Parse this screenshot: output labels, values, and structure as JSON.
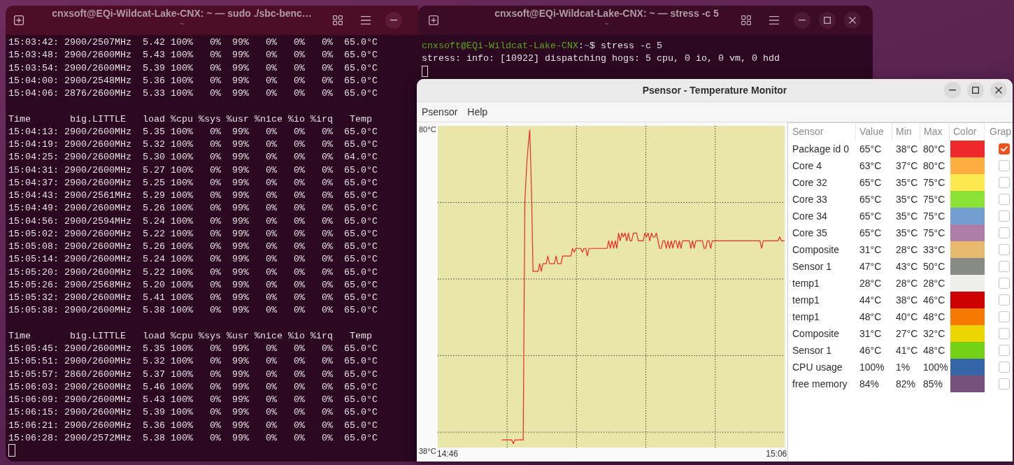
{
  "left_terminal": {
    "title": "cnxsoft@EQi-Wildcat-Lake-CNX: ~ — sudo ./sbc-benc…",
    "subtitle": "~",
    "blocks": [
      {
        "lines": [
          "15:03:42: 2900/2507MHz  5.42 100%   0%  99%   0%   0%   0%  65.0°C",
          "15:03:48: 2900/2600MHz  5.43 100%   0%  99%   0%   0%   0%  65.0°C",
          "15:03:54: 2900/2600MHz  5.39 100%   0%  99%   0%   0%   0%  65.0°C",
          "15:04:00: 2900/2548MHz  5.36 100%   0%  99%   0%   0%   0%  65.0°C",
          "15:04:06: 2876/2600MHz  5.33 100%   0%  99%   0%   0%   0%  65.0°C"
        ]
      },
      {
        "lines": [
          "Time       big.LITTLE   load %cpu %sys %usr %nice %io %irq   Temp",
          "15:04:13: 2900/2600MHz  5.35 100%   0%  99%   0%   0%   0%  65.0°C",
          "15:04:19: 2900/2600MHz  5.32 100%   0%  99%   0%   0%   0%  65.0°C",
          "15:04:25: 2900/2600MHz  5.30 100%   0%  99%   0%   0%   0%  64.0°C",
          "15:04:31: 2900/2600MHz  5.27 100%   0%  99%   0%   0%   0%  65.0°C",
          "15:04:37: 2900/2600MHz  5.25 100%   0%  99%   0%   0%   0%  65.0°C",
          "15:04:43: 2900/2561MHz  5.29 100%   0%  99%   0%   0%   0%  65.0°C",
          "15:04:49: 2900/2600MHz  5.26 100%   0%  99%   0%   0%   0%  65.0°C",
          "15:04:56: 2900/2594MHz  5.24 100%   0%  99%   0%   0%   0%  65.0°C",
          "15:05:02: 2900/2600MHz  5.22 100%   0%  99%   0%   0%   0%  65.0°C",
          "15:05:08: 2900/2600MHz  5.26 100%   0%  99%   0%   0%   0%  65.0°C",
          "15:05:14: 2900/2600MHz  5.24 100%   0%  99%   0%   0%   0%  65.0°C",
          "15:05:20: 2900/2600MHz  5.22 100%   0%  99%   0%   0%   0%  65.0°C",
          "15:05:26: 2900/2568MHz  5.20 100%   0%  99%   0%   0%   0%  65.0°C",
          "15:05:32: 2900/2600MHz  5.41 100%   0%  99%   0%   0%   0%  65.0°C",
          "15:05:38: 2900/2600MHz  5.38 100%   0%  99%   0%   0%   0%  65.0°C"
        ]
      },
      {
        "lines": [
          "Time       big.LITTLE   load %cpu %sys %usr %nice %io %irq   Temp",
          "15:05:45: 2900/2600MHz  5.35 100%   0%  99%   0%   0%   0%  65.0°C",
          "15:05:51: 2900/2600MHz  5.32 100%   0%  99%   0%   0%   0%  65.0°C",
          "15:05:57: 2860/2600MHz  5.37 100%   0%  99%   0%   0%   0%  65.0°C",
          "15:06:03: 2900/2600MHz  5.46 100%   0%  99%   0%   0%   0%  65.0°C",
          "15:06:09: 2900/2600MHz  5.43 100%   0%  99%   0%   0%   0%  65.0°C",
          "15:06:15: 2900/2600MHz  5.39 100%   0%  99%   0%   0%   0%  65.0°C",
          "15:06:21: 2900/2600MHz  5.36 100%   0%  99%   0%   0%   0%  65.0°C",
          "15:06:28: 2900/2572MHz  5.38 100%   0%  99%   0%   0%   0%  65.0°C"
        ]
      }
    ]
  },
  "right_terminal": {
    "title": "cnxsoft@EQi-Wildcat-Lake-CNX: ~ — stress -c 5",
    "subtitle": "~",
    "prompt": [
      {
        "kind": "user_host",
        "text": "cnxsoft@EQi-Wildcat-Lake-CNX"
      },
      {
        "kind": "text",
        "text": ":"
      },
      {
        "kind": "path",
        "text": "~"
      },
      {
        "kind": "text",
        "text": "$ stress -c 5"
      }
    ],
    "output": [
      "stress: info: [10922] dispatching hogs: 5 cpu, 0 io, 0 vm, 0 hdd"
    ]
  },
  "psensor": {
    "title": "Psensor - Temperature Monitor",
    "menu": [
      "Psensor",
      "Help"
    ],
    "chart_data": {
      "type": "line",
      "ylim": [
        38,
        80
      ],
      "yticks": [
        {
          "value": 80,
          "label": "80°C"
        },
        {
          "value": 38,
          "label": "38°C"
        }
      ],
      "categories": [
        "14:46",
        null,
        null,
        null,
        null,
        null,
        null,
        null,
        null,
        null,
        null,
        null,
        null,
        null,
        null,
        null,
        null,
        null,
        null,
        null,
        null,
        null,
        null,
        null,
        null,
        null,
        null,
        null,
        null,
        null,
        null,
        null,
        null,
        null,
        null,
        null,
        null,
        null,
        null,
        null,
        null,
        null,
        null,
        null,
        null,
        null,
        null,
        null,
        null,
        null,
        null,
        null,
        null,
        null,
        null,
        null,
        null,
        null,
        null,
        null,
        null,
        null,
        null,
        null,
        null,
        null,
        null,
        null,
        null,
        null,
        null,
        null,
        null,
        null,
        null,
        null,
        null,
        null,
        null,
        null,
        null,
        null,
        null,
        null,
        null,
        null,
        null,
        null,
        null,
        null,
        null,
        null,
        null,
        null,
        null,
        null,
        null,
        null,
        null,
        null,
        null,
        null,
        null,
        null,
        null,
        null,
        null,
        null,
        null,
        null,
        null,
        null,
        null,
        null,
        null,
        null,
        null,
        null,
        null,
        null,
        null,
        null,
        null,
        null,
        null,
        null,
        null,
        null,
        null,
        null,
        null,
        null,
        null,
        null,
        null,
        null,
        null,
        null,
        null,
        null,
        null,
        null,
        null,
        null,
        null,
        null,
        null,
        null,
        null,
        null,
        null,
        null,
        null,
        null,
        null,
        null,
        null,
        null,
        null,
        null,
        null,
        null,
        null,
        null,
        null,
        null,
        null,
        null,
        null,
        null,
        null,
        null,
        null,
        null,
        null,
        null,
        null,
        null,
        null,
        null,
        null,
        null,
        null,
        null,
        null,
        null,
        null,
        null,
        null,
        null,
        null,
        null,
        null,
        null,
        null,
        null,
        null,
        null,
        null,
        null,
        "15:06",
        null,
        null,
        null,
        null,
        null
      ],
      "series": [
        {
          "color": "#ef2929",
          "values": [
            null,
            null,
            null,
            null,
            null,
            null,
            null,
            null,
            null,
            null,
            null,
            null,
            null,
            null,
            null,
            null,
            null,
            null,
            null,
            null,
            null,
            null,
            null,
            null,
            null,
            null,
            null,
            null,
            null,
            null,
            null,
            null,
            null,
            39,
            39,
            39,
            39,
            39,
            39,
            39,
            38.5,
            39,
            39,
            39,
            39,
            39,
            39,
            70,
            74.4,
            77.3,
            79.5,
            72,
            61,
            61,
            61,
            61,
            62,
            61,
            62,
            62,
            62,
            63,
            62,
            62,
            62,
            62,
            63,
            62,
            62,
            62,
            63,
            63,
            63,
            63,
            63,
            63,
            64,
            63.5,
            64,
            64,
            64,
            64,
            63.5,
            64,
            64,
            63,
            64,
            64,
            64,
            64,
            64,
            64,
            64,
            64,
            64,
            64,
            64,
            64,
            65,
            64,
            65,
            64,
            65,
            64,
            66,
            65,
            66,
            65.5,
            66,
            65,
            66,
            65,
            65,
            66,
            66,
            66,
            65,
            65,
            65,
            65,
            66,
            65.5,
            66,
            65,
            66,
            65.5,
            65.5,
            66,
            65,
            64,
            64,
            65,
            65,
            64,
            65,
            64,
            65,
            64,
            65,
            65,
            64,
            65,
            64,
            65,
            65,
            65,
            65,
            65,
            64,
            65,
            64,
            65,
            65,
            65,
            65,
            65,
            64,
            64,
            65,
            65,
            64,
            65,
            65,
            65,
            65,
            65,
            65,
            65,
            65,
            65,
            65,
            65,
            65,
            65,
            65,
            65,
            65,
            65,
            65,
            65,
            65,
            65,
            65,
            65,
            65,
            65,
            65,
            65,
            65,
            65,
            65,
            64,
            65,
            65,
            65,
            65,
            65,
            65,
            65,
            65,
            65,
            65,
            65.5,
            65,
            65,
            65
          ]
        }
      ]
    },
    "table": {
      "columns": [
        "Sensor",
        "Value",
        "Min",
        "Max",
        "Color",
        "Grap"
      ],
      "rows": [
        {
          "sensor": "Package id 0",
          "value": "65°C",
          "min": "38°C",
          "max": "80°C",
          "color": "#ef2929",
          "checked": true
        },
        {
          "sensor": "Core 4",
          "value": "63°C",
          "min": "37°C",
          "max": "80°C",
          "color": "#fcaf3e",
          "checked": false
        },
        {
          "sensor": "Core 32",
          "value": "65°C",
          "min": "35°C",
          "max": "75°C",
          "color": "#fce94f",
          "checked": false
        },
        {
          "sensor": "Core 33",
          "value": "65°C",
          "min": "35°C",
          "max": "75°C",
          "color": "#8ae234",
          "checked": false
        },
        {
          "sensor": "Core 34",
          "value": "65°C",
          "min": "35°C",
          "max": "75°C",
          "color": "#729fcf",
          "checked": false
        },
        {
          "sensor": "Core 35",
          "value": "65°C",
          "min": "35°C",
          "max": "75°C",
          "color": "#ad7fa8",
          "checked": false
        },
        {
          "sensor": "Composite",
          "value": "31°C",
          "min": "28°C",
          "max": "33°C",
          "color": "#e9b96e",
          "checked": false
        },
        {
          "sensor": "Sensor 1",
          "value": "47°C",
          "min": "43°C",
          "max": "50°C",
          "color": "#888a85",
          "checked": false
        },
        {
          "sensor": "temp1",
          "value": "28°C",
          "min": "28°C",
          "max": "28°C",
          "color": "#eeeeec",
          "checked": false
        },
        {
          "sensor": "temp1",
          "value": "44°C",
          "min": "38°C",
          "max": "46°C",
          "color": "#cc0000",
          "checked": false
        },
        {
          "sensor": "temp1",
          "value": "48°C",
          "min": "40°C",
          "max": "48°C",
          "color": "#f57900",
          "checked": false
        },
        {
          "sensor": "Composite",
          "value": "31°C",
          "min": "27°C",
          "max": "32°C",
          "color": "#edd400",
          "checked": false
        },
        {
          "sensor": "Sensor 1",
          "value": "46°C",
          "min": "41°C",
          "max": "48°C",
          "color": "#73d216",
          "checked": false
        },
        {
          "sensor": "CPU usage",
          "value": "100%",
          "min": "1%",
          "max": "100%",
          "color": "#3465a4",
          "checked": false
        },
        {
          "sensor": "free memory",
          "value": "84%",
          "min": "82%",
          "max": "85%",
          "color": "#75507b",
          "checked": false
        }
      ]
    }
  }
}
